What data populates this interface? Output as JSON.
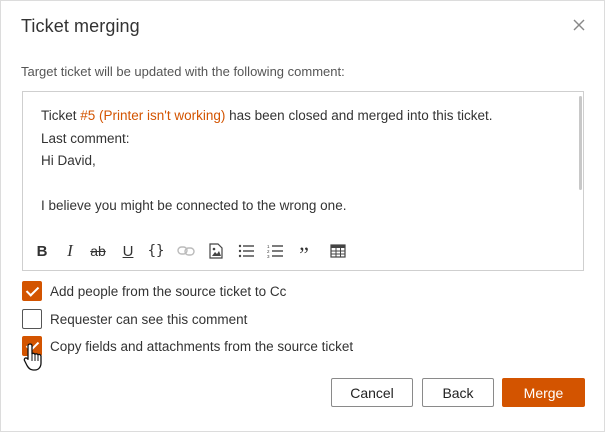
{
  "dialog": {
    "title": "Ticket merging",
    "subtitle": "Target ticket will be updated with the following comment:"
  },
  "editor": {
    "line1_prefix": "Ticket ",
    "ticket_link": "#5 (Printer isn't working)",
    "line1_suffix": " has been closed and merged into this ticket.",
    "line2": "Last comment:",
    "line3": "Hi David,",
    "line4": "",
    "line5": "I believe you might be connected to the wrong one.",
    "toolbar": [
      "bold-icon",
      "italic-icon",
      "strikethrough-icon",
      "underline-icon",
      "code-block-icon",
      "link-icon",
      "image-icon",
      "bulleted-list-icon",
      "numbered-list-icon",
      "quote-icon",
      "table-icon"
    ],
    "toolbar_glyphs": {
      "bold": "B",
      "italic": "I",
      "strike": "ab",
      "underline": "U",
      "code": "{}",
      "quote": "”"
    }
  },
  "options": [
    {
      "label": "Add people from the source ticket to Cc",
      "checked": true
    },
    {
      "label": "Requester can see this comment",
      "checked": false
    },
    {
      "label": "Copy fields and attachments from the source ticket",
      "checked": true
    }
  ],
  "buttons": {
    "cancel": "Cancel",
    "back": "Back",
    "merge": "Merge"
  },
  "colors": {
    "accent": "#d35400",
    "text": "#333333",
    "border": "#cfcfcf"
  }
}
